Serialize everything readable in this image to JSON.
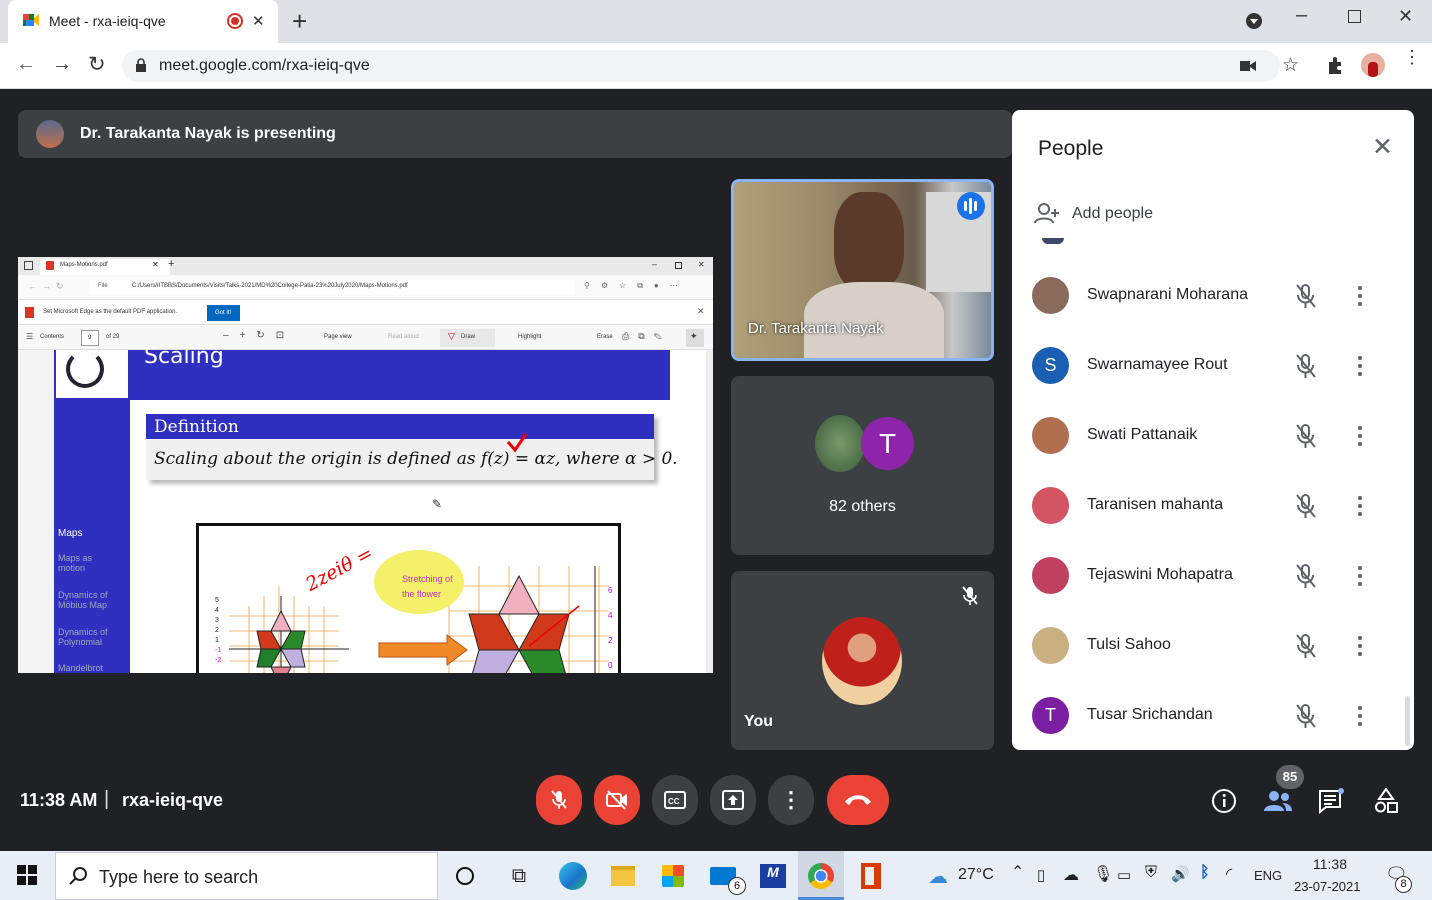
{
  "browser": {
    "tab_title": "Meet - rxa-ieiq-qve",
    "tab_close": "✕",
    "new_tab": "+",
    "url": "meet.google.com/rxa-ieiq-qve"
  },
  "meet": {
    "presenting_text": "Dr. Tarakanta Nayak is presenting",
    "presenter_name": "Dr. Tarakanta Nayak",
    "others_label": "82 others",
    "others_initial": "T",
    "you_label": "You",
    "time": "11:38 AM",
    "separator": "|",
    "meeting_code": "rxa-ieiq-qve",
    "people_count": "85"
  },
  "pdf": {
    "tab_title": "Maps-Motions.pdf",
    "file_prefix": "File",
    "path": "C:/Users/IITBBS/Documents/Visits/Talks-2021/MD%20College-Patia-23%20July2020/Maps-Motions.pdf",
    "default_msg": "Set Microsoft Edge as the default PDF application.",
    "got_it": "Got it!",
    "contents": "Contents",
    "page_num": "9",
    "of_pages": "of 29",
    "page_view": "Page view",
    "read_aloud": "Read aloud",
    "draw": "Draw",
    "highlight": "Highlight",
    "erase": "Erase",
    "slide_title": "Scaling",
    "def_title": "Definition",
    "def_text_a": "Scaling about the origin is defined as ",
    "def_text_b": "f(z) = αz",
    "def_text_c": ", where α > 0.",
    "nav": [
      "Maps",
      "Maps as motion",
      "Dynamics of Möbius Map",
      "Dynamics of Polynomial",
      "Mandelbrot"
    ],
    "bubble": "Stretching of the flower",
    "handwriting": "2zeiθ =",
    "axis_left": [
      "5",
      "4",
      "3",
      "2",
      "1",
      "-1",
      "-2"
    ],
    "axis_right": [
      "6",
      "4",
      "2",
      "0"
    ]
  },
  "people_panel": {
    "title": "People",
    "add_people": "Add people",
    "list": [
      {
        "name": "Swapnarani Moharana",
        "initial": "",
        "color": "#8a6a5a"
      },
      {
        "name": "Swarnamayee Rout",
        "initial": "S",
        "color": "#1a5fb4"
      },
      {
        "name": "Swati Pattanaik",
        "initial": "",
        "color": "#b07050"
      },
      {
        "name": "Taranisen mahanta",
        "initial": "",
        "color": "#d35462"
      },
      {
        "name": "Tejaswini Mohapatra",
        "initial": "",
        "color": "#c04060"
      },
      {
        "name": "Tulsi Sahoo",
        "initial": "",
        "color": "#c8b080"
      },
      {
        "name": "Tusar Srichandan",
        "initial": "T",
        "color": "#7b1fa2"
      }
    ]
  },
  "taskbar": {
    "search_placeholder": "Type here to search",
    "weather": "27°C",
    "lang": "ENG",
    "time": "11:38",
    "date": "23-07-2021",
    "mail_badge": "6",
    "notif_badge": "8"
  },
  "colors": {
    "accent": "#1a73e8",
    "danger": "#ea4335",
    "meet_bg": "#202124"
  }
}
